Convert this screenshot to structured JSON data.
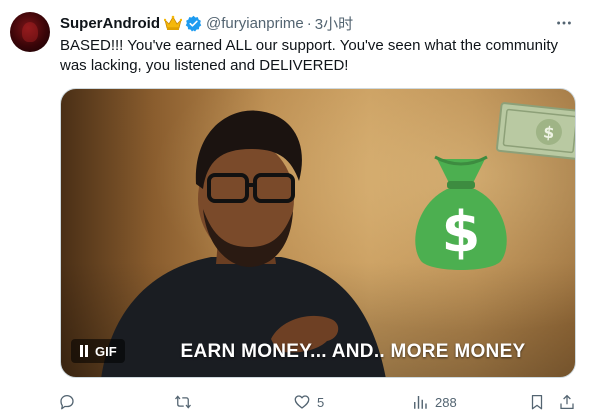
{
  "tweet": {
    "display_name": "SuperAndroid",
    "handle": "@furyianprime",
    "separator": "·",
    "time": "3小时",
    "text": "BASED!!! You've earned ALL our support. You've seen what the community was lacking, you listened and DELIVERED!",
    "badges": {
      "crown": "crown-emoji",
      "verified": "verified-icon"
    },
    "media": {
      "type": "GIF",
      "gif_label": "GIF",
      "caption": "EARN MONEY... AND.. MORE MONEY"
    },
    "actions": {
      "reply": {
        "icon": "reply-icon",
        "count": ""
      },
      "retweet": {
        "icon": "retweet-icon",
        "count": ""
      },
      "like": {
        "icon": "heart-icon",
        "count": "5"
      },
      "views": {
        "icon": "views-icon",
        "count": "288"
      },
      "bookmark": {
        "icon": "bookmark-icon"
      },
      "share": {
        "icon": "share-icon"
      }
    }
  },
  "colors": {
    "verified": "#1d9bf0",
    "text_secondary": "#536471",
    "money_green": "#4caf50"
  }
}
